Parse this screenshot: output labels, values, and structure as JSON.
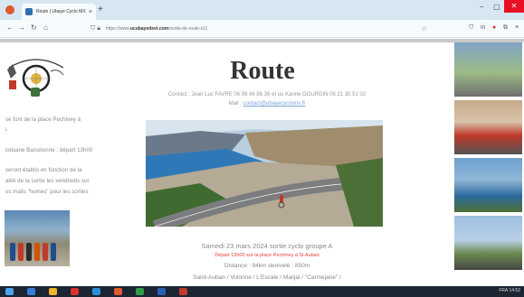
{
  "browser": {
    "tab_title": "Route | Ubaye Cyclo MX",
    "tab_close": "×",
    "new_tab": "+",
    "url_prefix": "https://www.",
    "url_domain": "ucubayedevt.com",
    "url_path": "/sortie-de-route-s11",
    "minimize": "–",
    "maximize": "▢",
    "close": "✕"
  },
  "page": {
    "title": "Route",
    "contact": "Contact : Jean Luc FAVRE 06 08 84 86 39 et ou Karine GOURDIN 06 21 30 51 02",
    "mail_label": "Mail : ",
    "mail_link": "contact@ubayecyclomx.fr"
  },
  "sidebar_left": {
    "lines": [
      "se font de la place Pechiney à",
      "i.",
      "lotisane Barcelonne : départ 13h00",
      "seront établis en fonction de la",
      "alité de la sortie les vendredis sur",
      "os mails \"homes\" pour les sorties"
    ]
  },
  "event": {
    "title": "Samedi 23 mars 2024 sortie cyclo groupe A",
    "departure": "Départ 13h00 sur la place Pechiney à St Auban",
    "distance": "Distance : 94km denivelé : 850m",
    "route": "Saint-Auban / Volonne / L'Escale / Malijai / \"Carmejane\" /"
  },
  "taskbar": {
    "tray": "FRA  14:52"
  }
}
